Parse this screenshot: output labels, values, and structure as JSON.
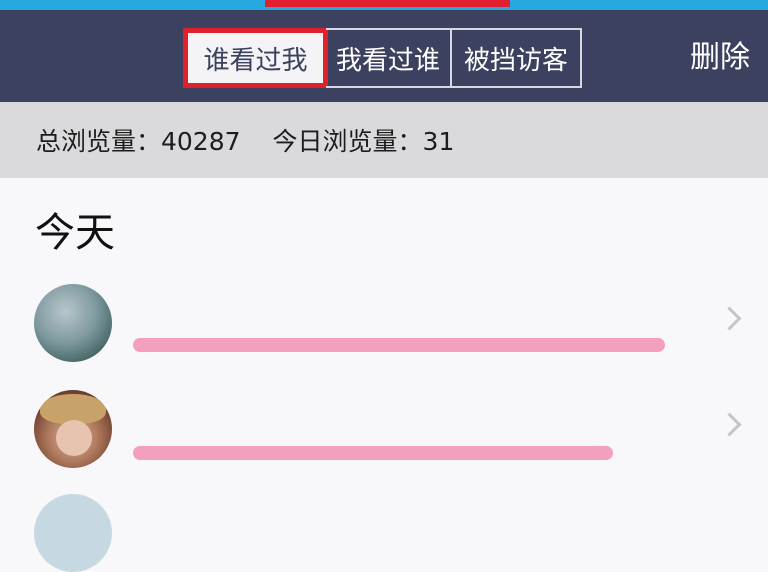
{
  "nav": {
    "tabs": [
      {
        "label": "谁看过我",
        "active": true
      },
      {
        "label": "我看过谁",
        "active": false
      },
      {
        "label": "被挡访客",
        "active": false
      }
    ],
    "delete_label": "删除"
  },
  "stats": {
    "total_views": "总浏览量：40287",
    "today_views": "今日浏览量：31"
  },
  "visitors": {
    "section_title": "今天",
    "items": [
      {
        "avatar": "landscape-avatar"
      },
      {
        "avatar": "anime-character-avatar"
      }
    ]
  },
  "colors": {
    "navbar_bg": "#3d4160",
    "active_tab_border": "#e0202a",
    "stats_bg": "#dadadd",
    "redaction": "#f29fc0"
  }
}
